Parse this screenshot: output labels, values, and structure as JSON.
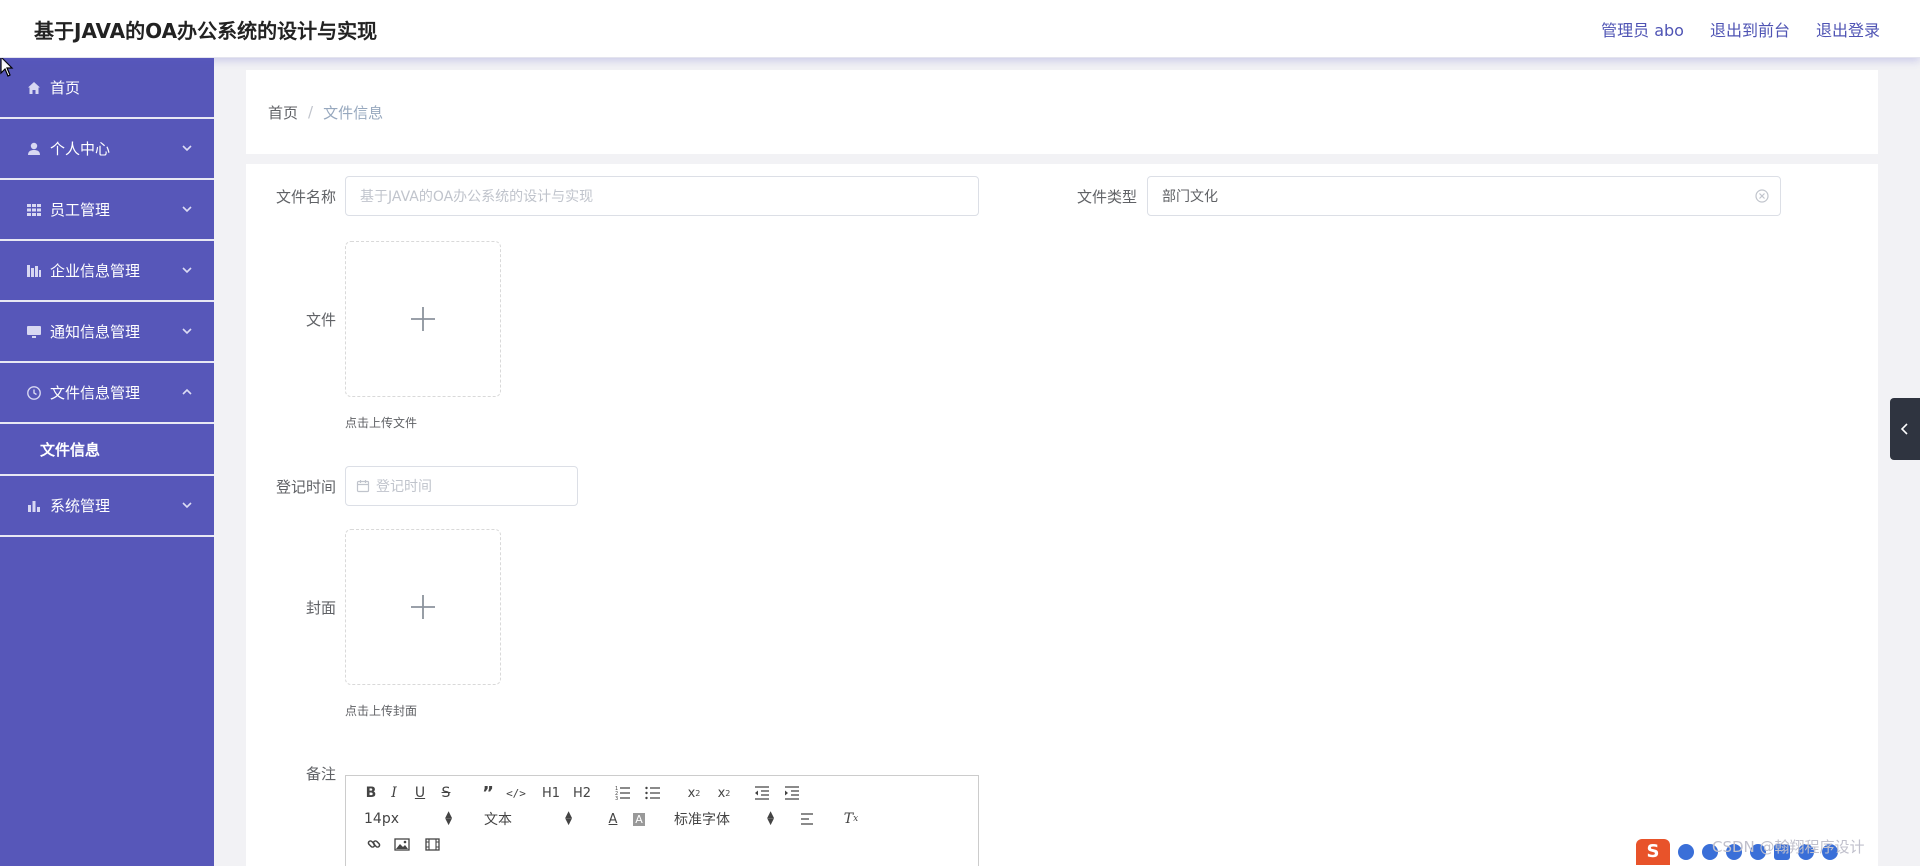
{
  "header": {
    "app_title": "基于JAVA的OA办公系统的设计与实现",
    "links": [
      "管理员 abo",
      "退出到前台",
      "退出登录"
    ]
  },
  "sidebar": {
    "items": [
      {
        "label": "首页",
        "icon": "home-icon",
        "expandable": false
      },
      {
        "label": "个人中心",
        "icon": "user-icon",
        "expandable": true
      },
      {
        "label": "员工管理",
        "icon": "grid-icon",
        "expandable": true
      },
      {
        "label": "企业信息管理",
        "icon": "bar-icon",
        "expandable": true
      },
      {
        "label": "通知信息管理",
        "icon": "monitor-icon",
        "expandable": true
      },
      {
        "label": "文件信息管理",
        "icon": "clock-icon",
        "expandable": true,
        "expanded": true
      },
      {
        "label": "系统管理",
        "icon": "chart-icon",
        "expandable": true
      }
    ],
    "submenu": {
      "label": "文件信息"
    }
  },
  "breadcrumb": {
    "home": "首页",
    "separator": "/",
    "current": "文件信息"
  },
  "form": {
    "name_label": "文件名称",
    "name_value": "基于JAVA的OA办公系统的设计与实现",
    "type_label": "文件类型",
    "type_value": "部门文化",
    "file_label": "文件",
    "file_tip": "点击上传文件",
    "time_label": "登记时间",
    "time_placeholder": "登记时间",
    "cover_label": "封面",
    "cover_tip": "点击上传封面",
    "note_label": "备注"
  },
  "editor": {
    "size_value": "14px",
    "header_value": "文本",
    "font_value": "标准字体",
    "h1": "H1",
    "h2": "H2"
  },
  "watermark": "CSDN @翰翔程序设计",
  "colors": {
    "sidebar_bg": "#5757b9",
    "accent": "#4f54b4"
  }
}
